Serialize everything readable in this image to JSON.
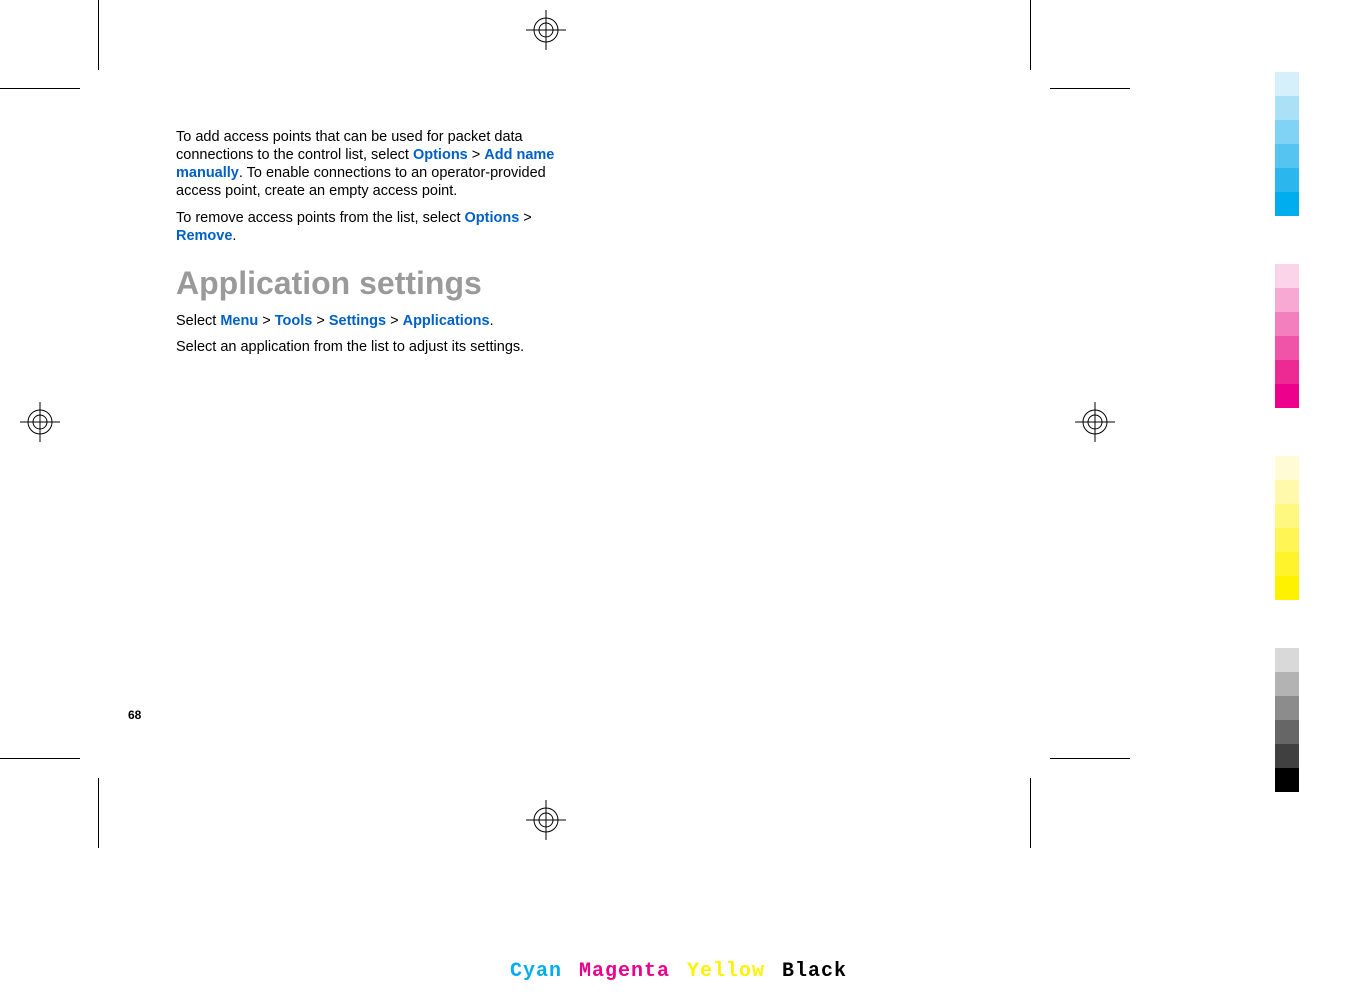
{
  "page": {
    "number": "68"
  },
  "body": {
    "p1_a": "To add access points that can be used for packet data connections to the control list, select ",
    "p1_link1": "Options",
    "p1_sep": " > ",
    "p1_link2": "Add name manually",
    "p1_b": ". To enable connections to an operator-provided access point, create an empty access point.",
    "p2_a": "To remove access points from the list, select ",
    "p2_link1": "Options",
    "p2_sep": " > ",
    "p2_link2": "Remove",
    "p2_b": ".",
    "heading": "Application settings",
    "p3_a": "Select ",
    "p3_link1": "Menu",
    "p3_sep1": " > ",
    "p3_link2": "Tools",
    "p3_sep2": " > ",
    "p3_link3": "Settings",
    "p3_sep3": " > ",
    "p3_link4": "Applications",
    "p3_b": ".",
    "p4": "Select an application from the list to adjust its settings."
  },
  "footer": {
    "cyan": "Cyan",
    "magenta": "Magenta",
    "yellow": "Yellow",
    "black": "Black"
  },
  "colors": {
    "cyan": "#00aeef",
    "magenta": "#ec008c",
    "yellow": "#fff200",
    "black": "#000000"
  },
  "bars_cyan": [
    "#d5f0fb",
    "#abe1f7",
    "#80d3f4",
    "#55c4f0",
    "#2bb6ed",
    "#00aeef"
  ],
  "bars_magenta": [
    "#fbd4e9",
    "#f7a9d3",
    "#f47fbe",
    "#f054a8",
    "#ed2a93",
    "#ec008c"
  ],
  "bars_yellow": [
    "#fffcd5",
    "#fffaab",
    "#fff880",
    "#fff655",
    "#fff42b",
    "#fff200"
  ],
  "bars_black": [
    "#d9d9d9",
    "#b3b3b3",
    "#8c8c8c",
    "#666666",
    "#404040",
    "#000000"
  ]
}
